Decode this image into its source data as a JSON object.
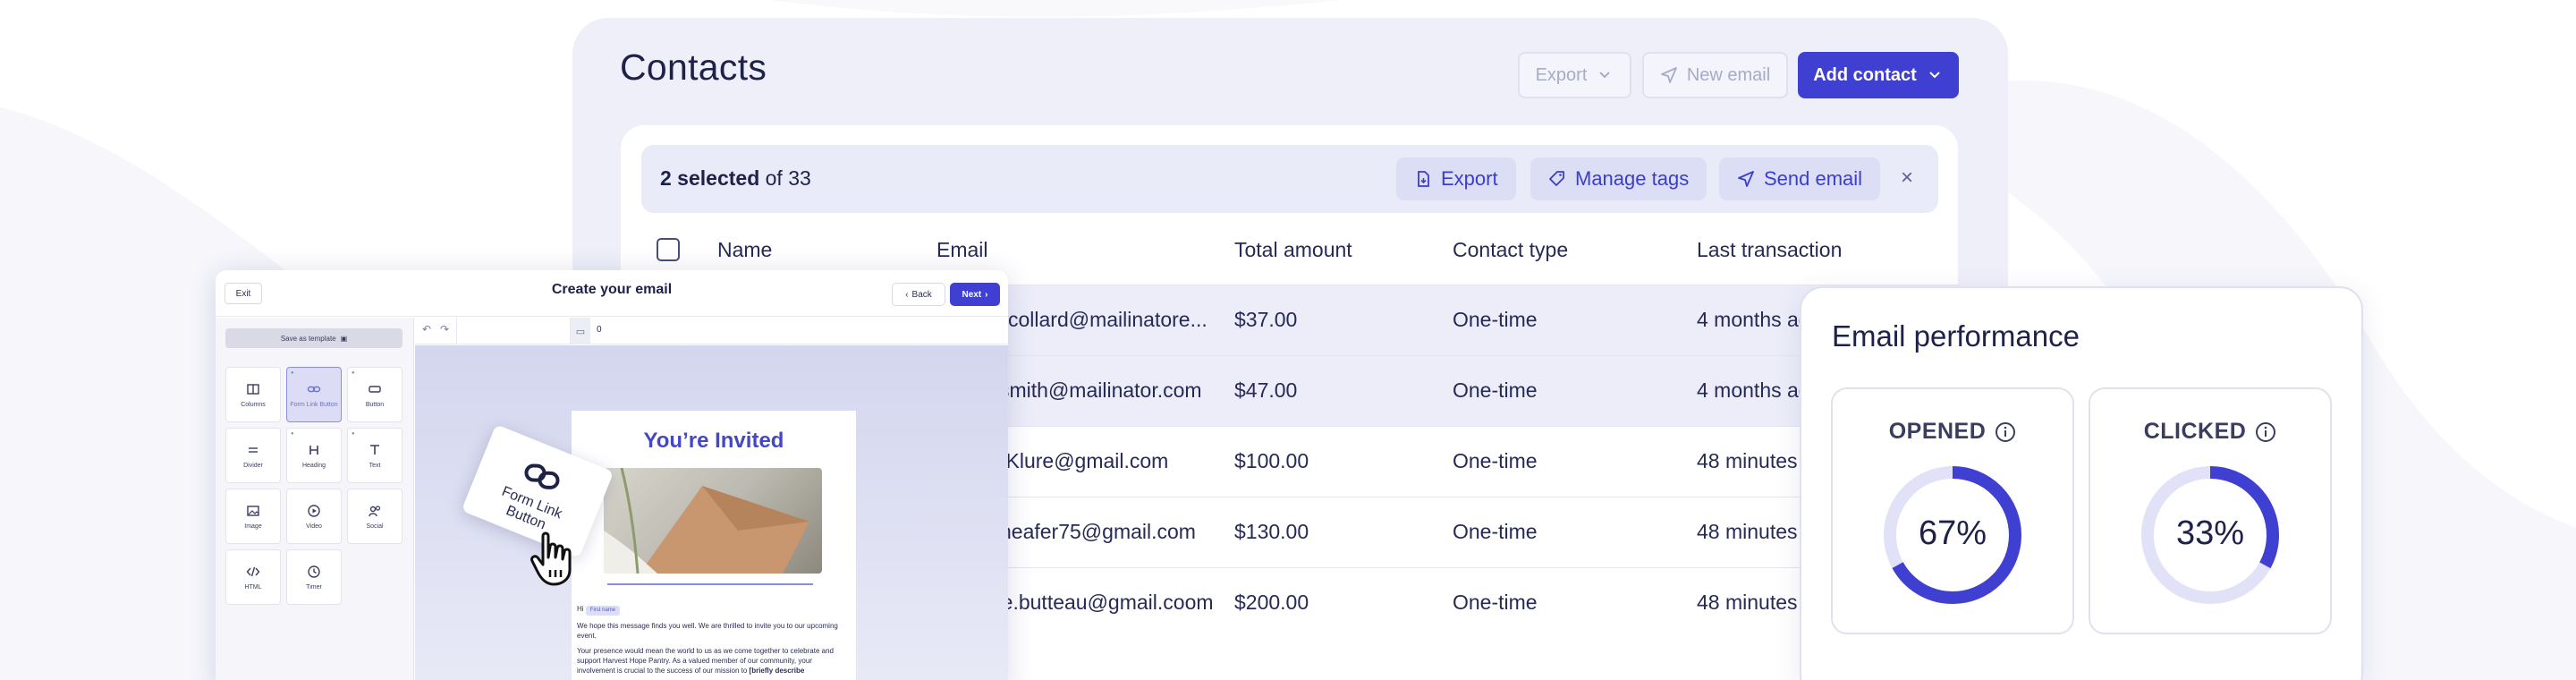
{
  "contacts": {
    "title": "Contacts",
    "header_buttons": {
      "export": "Export",
      "new_email": "New email",
      "add_contact": "Add contact"
    },
    "selection": {
      "count_label": "2 selected",
      "of_label": "of 33"
    },
    "bulk_actions": {
      "export": "Export",
      "manage_tags": "Manage tags",
      "send_email": "Send email"
    },
    "columns": [
      "Name",
      "Email",
      "Total amount",
      "Contact type",
      "Last transaction"
    ],
    "rows": [
      {
        "email": "collard@mailinatore...",
        "amount": "$37.00",
        "type": "One-time",
        "last": "4 months ago",
        "selected": true
      },
      {
        "email": "smith@mailinator.com",
        "amount": "$47.00",
        "type": "One-time",
        "last": "4 months ago",
        "selected": true
      },
      {
        "email": "cKlure@gmail.com",
        "amount": "$100.00",
        "type": "One-time",
        "last": "48 minutes",
        "selected": false
      },
      {
        "email": "heafer75@gmail.com",
        "amount": "$130.00",
        "type": "One-time",
        "last": "48 minutes",
        "selected": false
      },
      {
        "email": "re.butteau@gmail.coom",
        "amount": "$200.00",
        "type": "One-time",
        "last": "48 minutes",
        "selected": false
      }
    ]
  },
  "builder": {
    "exit": "Exit",
    "title": "Create your email",
    "back": "Back",
    "next": "Next",
    "save_template": "Save as template",
    "toolbar_zoom": "0",
    "tiles": [
      {
        "label": "Columns",
        "icon": "columns-icon"
      },
      {
        "label": "Form Link Button",
        "icon": "link-icon"
      },
      {
        "label": "Button",
        "icon": "button-icon"
      },
      {
        "label": "Divider",
        "icon": "divider-icon"
      },
      {
        "label": "Heading",
        "icon": "heading-icon"
      },
      {
        "label": "Text",
        "icon": "text-icon"
      },
      {
        "label": "Image",
        "icon": "image-icon"
      },
      {
        "label": "Video",
        "icon": "video-icon"
      },
      {
        "label": "Social",
        "icon": "social-icon"
      },
      {
        "label": "HTML",
        "icon": "code-icon"
      },
      {
        "label": "Timer",
        "icon": "timer-icon"
      }
    ],
    "email": {
      "heading": "You’re Invited",
      "greeting": "Hi",
      "first_name_chip": "First name",
      "para1": "We hope this message finds you well. We are thrilled to invite you to our upcoming event.",
      "para2": "Your presence would mean the world to us as we come together to celebrate and support Harvest Hope Pantry. As a valued member of our community, your involvement is crucial to the success of our mission to",
      "para2_bold": "[briefly describe"
    },
    "drag_card_label": "Form Link Button"
  },
  "performance": {
    "title": "Email performance",
    "metrics": [
      {
        "label": "OPENED",
        "value": "67%",
        "fraction": 0.67
      },
      {
        "label": "CLICKED",
        "value": "33%",
        "fraction": 0.33
      }
    ],
    "colors": {
      "accent": "#3f3fd1",
      "track": "#e1e1f7"
    }
  }
}
